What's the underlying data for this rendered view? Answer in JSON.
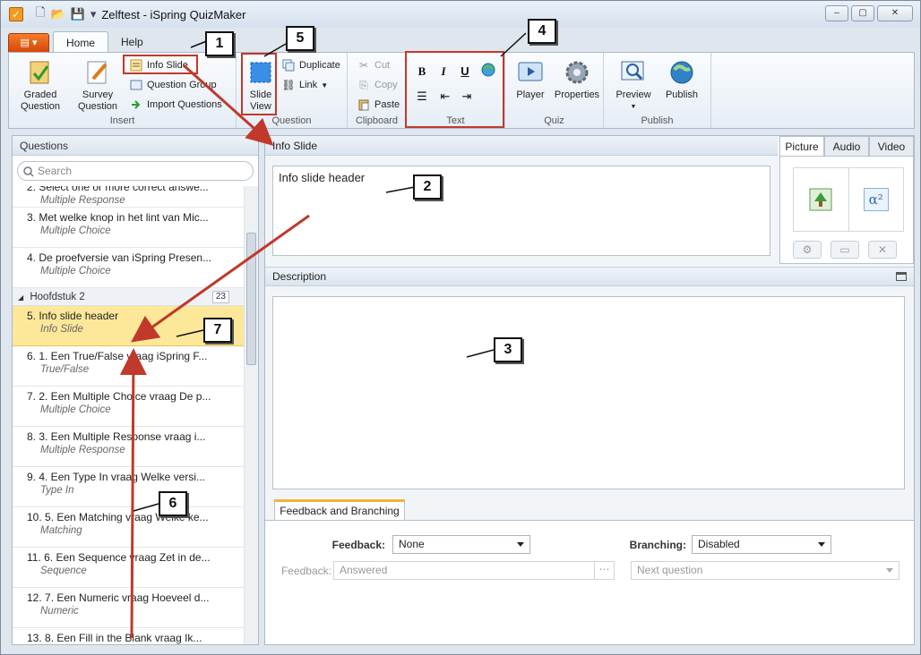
{
  "window": {
    "title": "Zelftest - iSpring QuizMaker",
    "controls": [
      "–",
      "▢",
      "✕"
    ]
  },
  "ribbon": {
    "file_label": "▤ ▾",
    "tabs": [
      "Home",
      "Help"
    ],
    "insert": {
      "graded_question": "Graded\nQuestion",
      "survey_question": "Survey\nQuestion",
      "info_slide": "Info Slide",
      "question_group": "Question Group",
      "import_questions": "Import Questions",
      "label": "Insert"
    },
    "question": {
      "slide_view": "Slide\nView",
      "duplicate": "Duplicate",
      "link": "Link",
      "label": "Question"
    },
    "clipboard": {
      "cut": "Cut",
      "copy": "Copy",
      "paste": "Paste",
      "label": "Clipboard"
    },
    "text": {
      "bold": "B",
      "italic": "I",
      "underline": "U",
      "label": "Text"
    },
    "quiz": {
      "player": "Player",
      "properties": "Properties",
      "label": "Quiz"
    },
    "publish": {
      "preview": "Preview",
      "publish": "Publish",
      "label": "Publish"
    }
  },
  "questions_panel": {
    "title": "Questions",
    "search_placeholder": "Search",
    "items_top": [
      {
        "title": "2. Select one or more correct answe...",
        "type": "Multiple Response"
      },
      {
        "title": "3. Met welke knop in het lint van Mic...",
        "type": "Multiple Choice"
      },
      {
        "title": "4. De proefversie van iSpring Presen...",
        "type": "Multiple Choice"
      }
    ],
    "chapter": {
      "name": "Hoofdstuk 2",
      "count": "23"
    },
    "items_bottom": [
      {
        "title": "5. Info slide header",
        "type": "Info Slide"
      },
      {
        "title": "6. 1. Een True/False vraag  iSpring F...",
        "type": "True/False"
      },
      {
        "title": "7. 2. Een Multiple Choice vraag  De p...",
        "type": "Multiple Choice"
      },
      {
        "title": "8. 3. Een Multiple Response vraag  i...",
        "type": "Multiple Response"
      },
      {
        "title": "9. 4. Een Type In vraag  Welke versi...",
        "type": "Type In"
      },
      {
        "title": "10. 5. Een Matching vraag  Welke ke...",
        "type": "Matching"
      },
      {
        "title": "11. 6. Een Sequence vraag  Zet in de...",
        "type": "Sequence"
      },
      {
        "title": "12. 7. Een Numeric vraag  Hoeveel d...",
        "type": "Numeric"
      },
      {
        "title": "13. 8. Een Fill in the Blank vraag  Ik...",
        "type": ""
      }
    ]
  },
  "editor": {
    "info_slide_header": "Info Slide",
    "info_slide_text": "Info slide header",
    "media_tabs": [
      "Picture",
      "Audio",
      "Video"
    ],
    "formula_symbol": "α²",
    "description_header": "Description",
    "feedback_tab": "Feedback and Branching",
    "feedback_label": "Feedback:",
    "feedback_value": "None",
    "branching_label": "Branching:",
    "branching_value": "Disabled",
    "feedback2_label": "Feedback:",
    "feedback2_value": "Answered",
    "next_question": "Next question"
  },
  "annotations": [
    "1",
    "2",
    "3",
    "4",
    "5",
    "6",
    "7"
  ],
  "colors": {
    "annotation": "#c0392b",
    "selected_row": "#fde89a",
    "accent": "#f29a1d"
  }
}
